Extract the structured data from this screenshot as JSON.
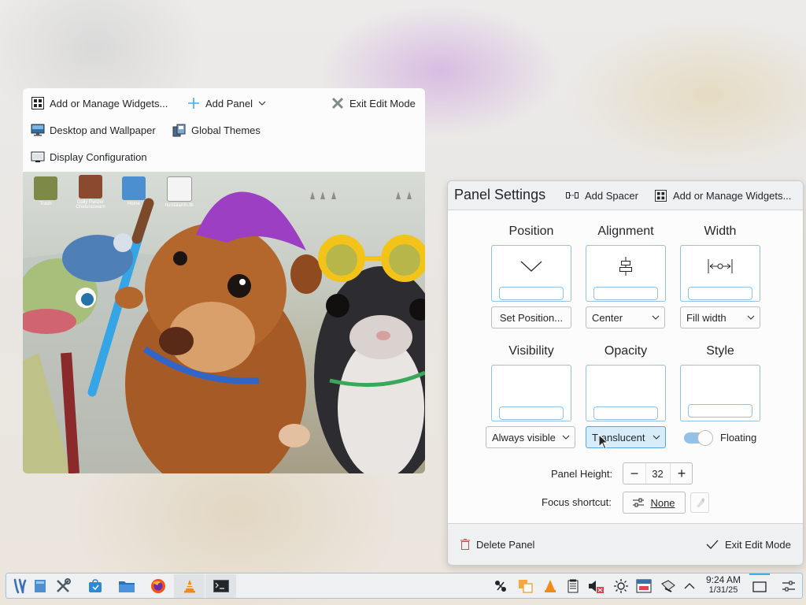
{
  "edit_toolbar": {
    "add_widgets": "Add or Manage Widgets...",
    "add_panel": "Add Panel",
    "exit_edit_mode": "Exit Edit Mode",
    "desktop_wallpaper": "Desktop and Wallpaper",
    "global_themes": "Global Themes",
    "display_configuration": "Display Configuration"
  },
  "desktop_preview": {
    "icons": [
      "Trash",
      "Daily Panzer Chaturaswarn",
      "Home",
      "hurdalarrin.tlk"
    ]
  },
  "panel_settings": {
    "title": "Panel Settings",
    "add_spacer": "Add Spacer",
    "add_widgets": "Add or Manage Widgets...",
    "position": {
      "title": "Position",
      "button": "Set Position..."
    },
    "alignment": {
      "title": "Alignment",
      "value": "Center"
    },
    "width": {
      "title": "Width",
      "value": "Fill width"
    },
    "visibility": {
      "title": "Visibility",
      "value": "Always visible"
    },
    "opacity": {
      "title": "Opacity",
      "value": "Translucent"
    },
    "style": {
      "title": "Style",
      "toggle_label": "Floating",
      "toggle_on": true
    },
    "panel_height": {
      "label": "Panel Height:",
      "value": "32",
      "minus": "−",
      "plus": "+"
    },
    "focus_shortcut": {
      "label": "Focus shortcut:",
      "value": "None"
    },
    "delete_panel": "Delete Panel",
    "exit_edit_mode": "Exit Edit Mode"
  },
  "taskbar": {
    "apps": [
      "kde-launcher-icon",
      "show-desktop-icon",
      "system-settings-icon",
      "discover-icon",
      "file-manager-icon",
      "firefox-icon",
      "vlc-icon",
      "terminal-icon"
    ],
    "clock": {
      "time": "9:24 AM",
      "date": "1/31/25"
    }
  },
  "colors": {
    "accent": "#3daee9",
    "accent_light": "#93c1e8",
    "danger": "#da4453"
  }
}
